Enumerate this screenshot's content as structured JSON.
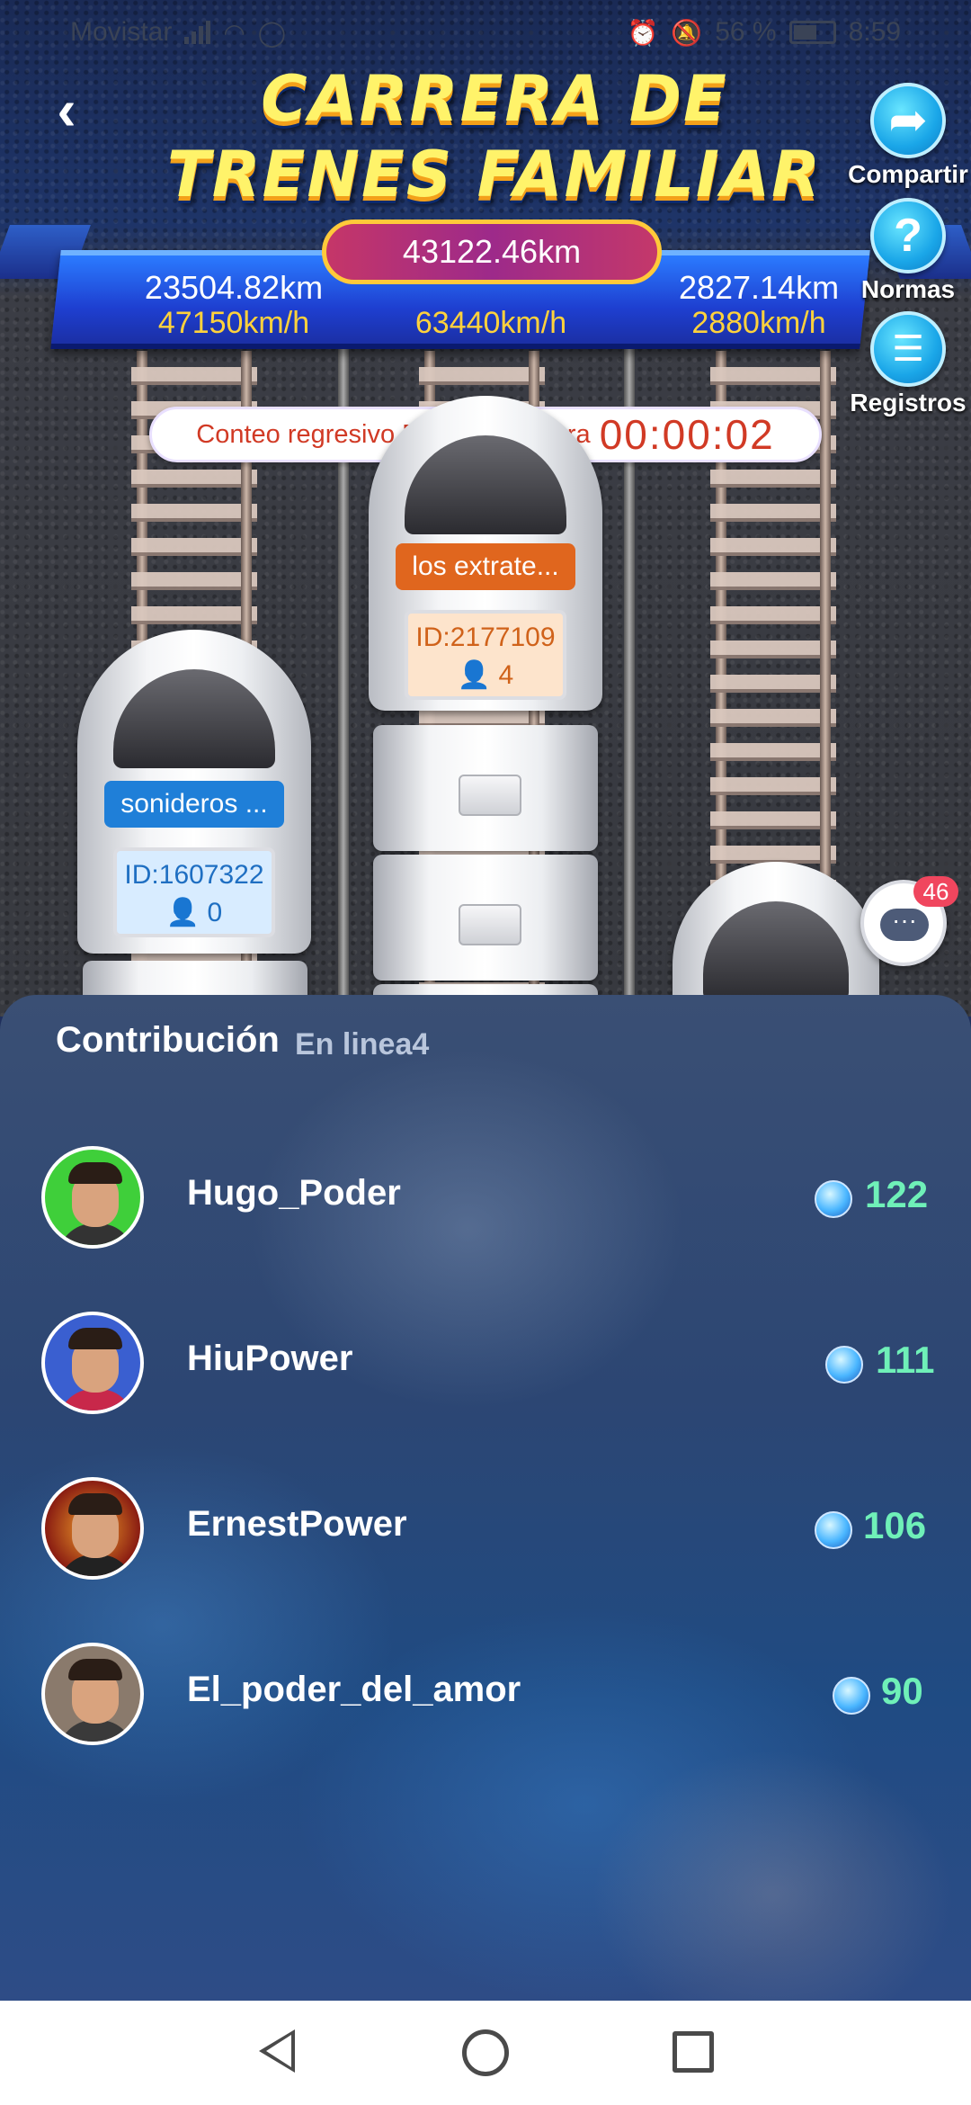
{
  "status_bar": {
    "carrier": "Movistar",
    "battery_text": "56 %",
    "time": "8:59",
    "icons": [
      "signal-icon",
      "wifi-icon",
      "whatsapp-icon",
      "alarm-icon",
      "mute-icon",
      "battery-icon"
    ]
  },
  "header": {
    "title_line1": "CARRERA DE",
    "title_line2": "TRENES FAMILIAR",
    "back_icon": "back-arrow-icon"
  },
  "actions": {
    "share": {
      "label": "Compartir",
      "icon": "share-icon"
    },
    "rules": {
      "label": "Normas",
      "icon": "question-icon"
    },
    "records": {
      "label": "Registros",
      "icon": "records-icon"
    }
  },
  "race": {
    "total_distance": "43122.46km",
    "lanes": [
      {
        "distance": "23504.82km",
        "speed": "47150km/h"
      },
      {
        "distance": "",
        "speed": "63440km/h"
      },
      {
        "distance": "2827.14km",
        "speed": "2880km/h"
      }
    ],
    "countdown_label": "Conteo regresivo Final de Carrera",
    "countdown_time": "00:00:02"
  },
  "trains": [
    {
      "name": "sonideros ...",
      "id": "ID:1607322",
      "members": "0",
      "tag_color": "#1f7fd8"
    },
    {
      "name": "los extrate...",
      "id": "ID:2177109",
      "members": "4",
      "tag_color": "#e0661e"
    }
  ],
  "chat": {
    "badge": "46",
    "icon": "chat-icon"
  },
  "contribution": {
    "title": "Contribución",
    "online": "En linea4",
    "rows": [
      {
        "name": "Hugo_Poder",
        "score": "122"
      },
      {
        "name": "HiuPower",
        "score": "111"
      },
      {
        "name": "ErnestPower",
        "score": "106"
      },
      {
        "name": "El_poder_del_amor",
        "score": "90"
      }
    ]
  },
  "colors": {
    "accent_yellow": "#fff36a",
    "score_green": "#6ff0b8",
    "countdown_red": "#d13a25",
    "pill_border": "#ffc93a"
  }
}
